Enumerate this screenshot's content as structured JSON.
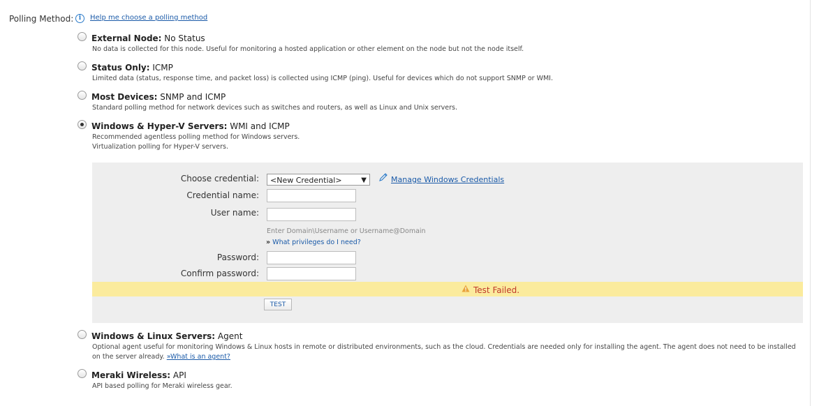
{
  "polling": {
    "label": "Polling Method:",
    "help_link": "Help me choose a polling method"
  },
  "options": [
    {
      "title_bold": "External Node:",
      "title_rest": " No Status",
      "desc": [
        "No data is collected for this node. Useful for monitoring a hosted application or other element on the node but not the node itself."
      ],
      "selected": false
    },
    {
      "title_bold": "Status Only:",
      "title_rest": " ICMP",
      "desc": [
        "Limited data (status, response time, and packet loss) is collected using ICMP (ping). Useful for devices which do not support SNMP or WMI."
      ],
      "selected": false
    },
    {
      "title_bold": "Most Devices:",
      "title_rest": " SNMP and ICMP",
      "desc": [
        "Standard polling method for network devices such as switches and routers, as well as Linux and Unix servers."
      ],
      "selected": false
    },
    {
      "title_bold": "Windows & Hyper-V Servers:",
      "title_rest": " WMI and ICMP",
      "desc": [
        "Recommended agentless polling method for Windows servers.",
        "Virtualization polling for Hyper-V servers."
      ],
      "selected": true
    },
    {
      "title_bold": "Windows & Linux Servers:",
      "title_rest": " Agent",
      "desc": [
        "Optional agent useful for monitoring Windows & Linux hosts in remote or distributed environments, such as the cloud. Credentials are needed only for installing the agent. The agent does not need to be installed",
        "on the server already."
      ],
      "link": "»What is an agent?",
      "selected": false
    },
    {
      "title_bold": "Meraki Wireless:",
      "title_rest": " API",
      "desc": [
        "API based polling for Meraki wireless gear."
      ],
      "selected": false
    }
  ],
  "credentials": {
    "choose_label": "Choose credential:",
    "choose_value": "<New Credential>",
    "manage_link": "Manage Windows Credentials",
    "name_label": "Credential name:",
    "user_label": "User name:",
    "user_hint": "Enter Domain\\Username or Username@Domain",
    "privileges_bullet": "»",
    "privileges_link": "What privileges do I need?",
    "password_label": "Password:",
    "confirm_label": "Confirm password:",
    "test_status": "Test Failed.",
    "test_button": "TEST"
  },
  "colors": {
    "link": "#1a5aa8",
    "panel_bg": "#eeeeee",
    "fail_bg": "#fbeb9d",
    "fail_text": "#c0392b",
    "warning_icon": "#e8a33a"
  },
  "icons": {
    "info": "info-icon",
    "pencil": "pencil-icon",
    "warning": "warning-icon",
    "dropdown": "chevron-down-icon"
  }
}
